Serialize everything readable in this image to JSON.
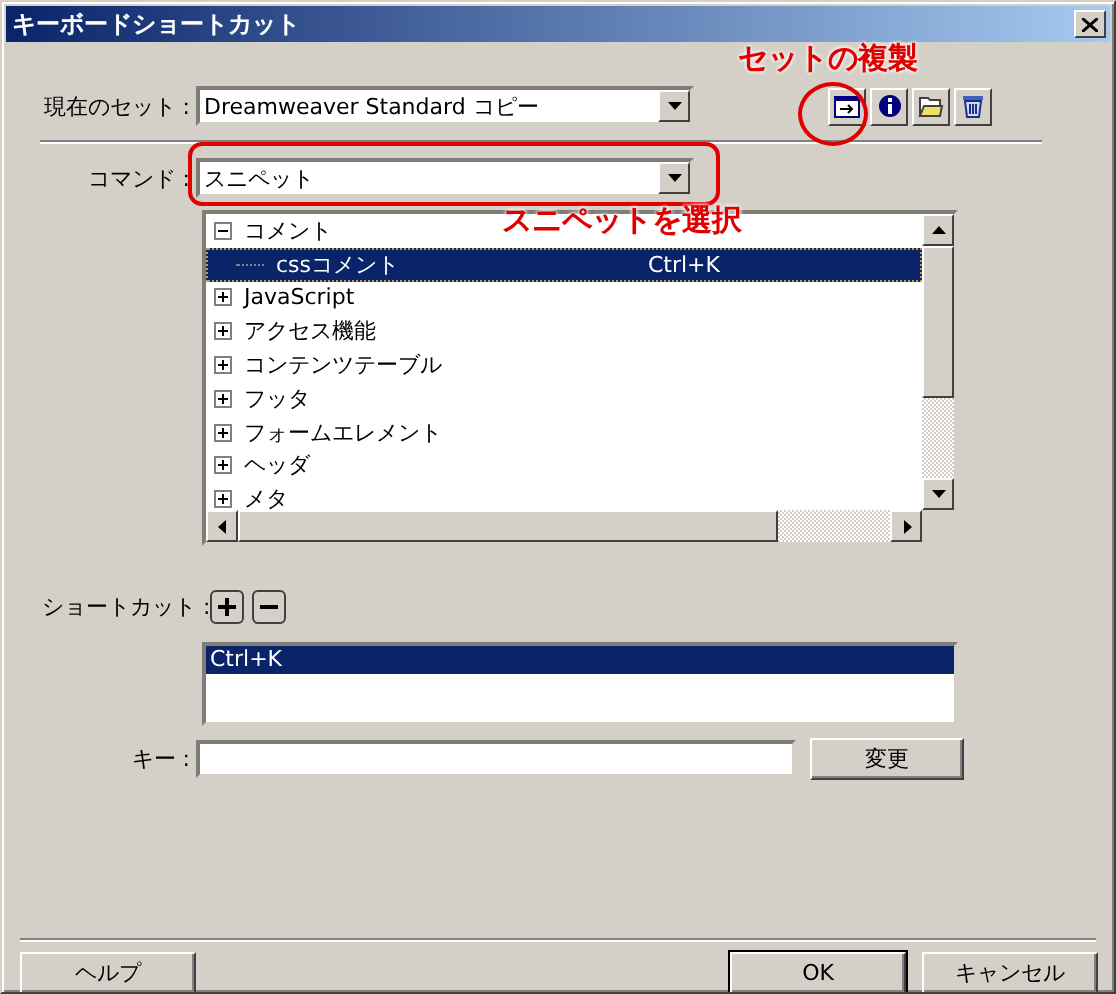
{
  "window": {
    "title": "キーボードショートカット"
  },
  "current_set": {
    "label": "現在のセット :",
    "value": "Dreamweaver Standard コピー"
  },
  "command": {
    "label": "コマンド :",
    "value": "スニペット"
  },
  "commands_tree": [
    {
      "label": "コメント",
      "expanded": true,
      "selected": false,
      "children": [
        {
          "label": "cssコメント",
          "shortcut": "Ctrl+K",
          "selected": true
        }
      ]
    },
    {
      "label": "JavaScript",
      "expanded": false,
      "selected": false
    },
    {
      "label": "アクセス機能",
      "expanded": false,
      "selected": false
    },
    {
      "label": "コンテンツテーブル",
      "expanded": false,
      "selected": false
    },
    {
      "label": "フッタ",
      "expanded": false,
      "selected": false
    },
    {
      "label": "フォームエレメント",
      "expanded": false,
      "selected": false
    },
    {
      "label": "ヘッダ",
      "expanded": false,
      "selected": false
    },
    {
      "label": "メタ",
      "expanded": false,
      "selected": false
    }
  ],
  "shortcuts": {
    "label": "ショートカット :",
    "items": [
      {
        "text": "Ctrl+K",
        "selected": true
      }
    ]
  },
  "key": {
    "label": "キー :",
    "button": "変更"
  },
  "buttons": [
    {
      "label": "ヘルプ",
      "default": false
    },
    {
      "label": "OK",
      "default": true
    },
    {
      "label": "キャンセル",
      "default": false
    }
  ],
  "annotations": [
    {
      "kind": "set-duplicate",
      "text": "セットの複製"
    },
    {
      "kind": "command",
      "text": "スニペットを選択"
    }
  ]
}
